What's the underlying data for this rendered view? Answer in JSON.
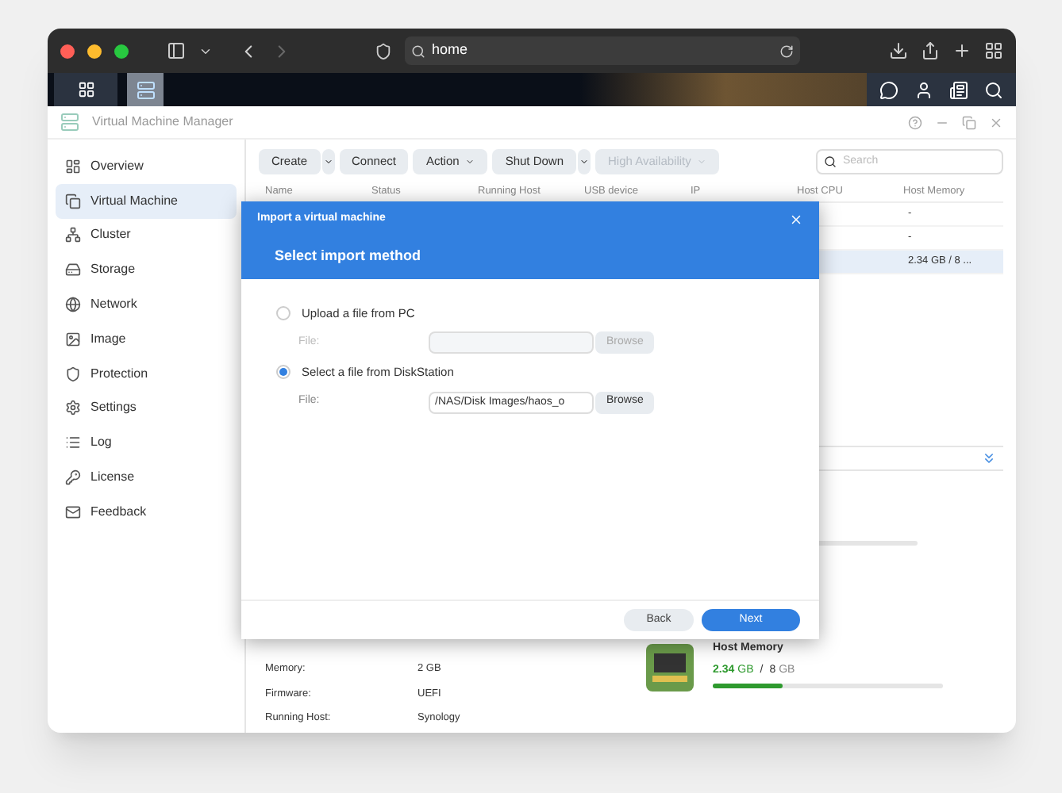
{
  "browser": {
    "address": "home"
  },
  "app": {
    "title": "Virtual Machine Manager"
  },
  "sidebar": {
    "items": [
      {
        "label": "Overview",
        "selected": false
      },
      {
        "label": "Virtual Machine",
        "selected": true
      },
      {
        "label": "Cluster",
        "selected": false
      },
      {
        "label": "Storage",
        "selected": false
      },
      {
        "label": "Network",
        "selected": false
      },
      {
        "label": "Image",
        "selected": false
      },
      {
        "label": "Protection",
        "selected": false
      },
      {
        "label": "Settings",
        "selected": false
      },
      {
        "label": "Log",
        "selected": false
      },
      {
        "label": "License",
        "selected": false
      },
      {
        "label": "Feedback",
        "selected": false
      }
    ]
  },
  "toolbar": {
    "buttons": [
      {
        "label": "Create",
        "kind": "split",
        "disabled": false
      },
      {
        "label": "Connect",
        "kind": "plain",
        "disabled": false
      },
      {
        "label": "Action",
        "kind": "menu",
        "disabled": false
      },
      {
        "label": "Shut Down",
        "kind": "split",
        "disabled": false
      },
      {
        "label": "High Availability",
        "kind": "menu",
        "disabled": true
      }
    ],
    "search": {
      "placeholder": "Search"
    }
  },
  "table": {
    "columns": [
      "Name",
      "Status",
      "Running Host",
      "USB device",
      "IP",
      "Host CPU",
      "Host Memory"
    ],
    "rows": [
      {
        "host_memory": "-",
        "selected": false
      },
      {
        "host_memory": "-",
        "selected": false
      },
      {
        "host_memory": "2.34 GB / 8 ...",
        "selected": true
      }
    ]
  },
  "details": {
    "fields": [
      {
        "label": "Memory:",
        "value": "2 GB"
      },
      {
        "label": "Firmware:",
        "value": "UEFI"
      },
      {
        "label": "Running Host:",
        "value": "Synology"
      }
    ],
    "host_memory": {
      "title": "Host Memory",
      "used": "2.34",
      "used_unit": "GB",
      "separator": "/",
      "total": "8",
      "total_unit": "GB",
      "level": 0.3
    }
  },
  "dialog": {
    "title": "Import a virtual machine",
    "heading": "Select import method",
    "options": [
      {
        "label": "Upload a file from PC",
        "selected": false,
        "file_label": "File:",
        "button": "Browse"
      },
      {
        "label": "Select a file from DiskStation",
        "selected": true,
        "file_label": "File:",
        "file_value": "/NAS/Disk Images/haos_o",
        "button": "Browse"
      }
    ],
    "buttons": [
      {
        "label": "Back",
        "kind": "secondary"
      },
      {
        "label": "Next",
        "kind": "primary"
      }
    ]
  }
}
